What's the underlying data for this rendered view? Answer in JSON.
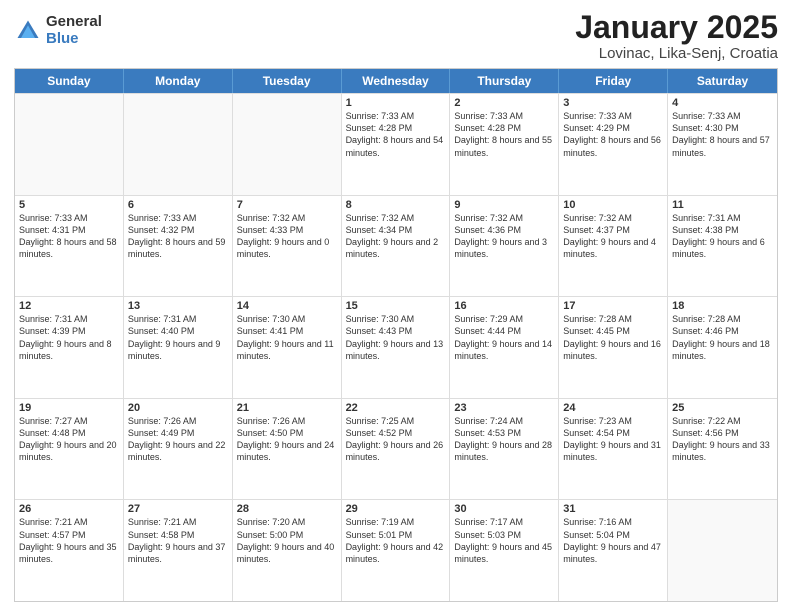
{
  "logo": {
    "general": "General",
    "blue": "Blue"
  },
  "header": {
    "title": "January 2025",
    "subtitle": "Lovinac, Lika-Senj, Croatia"
  },
  "weekdays": [
    "Sunday",
    "Monday",
    "Tuesday",
    "Wednesday",
    "Thursday",
    "Friday",
    "Saturday"
  ],
  "weeks": [
    [
      {
        "day": "",
        "info": ""
      },
      {
        "day": "",
        "info": ""
      },
      {
        "day": "",
        "info": ""
      },
      {
        "day": "1",
        "info": "Sunrise: 7:33 AM\nSunset: 4:28 PM\nDaylight: 8 hours\nand 54 minutes."
      },
      {
        "day": "2",
        "info": "Sunrise: 7:33 AM\nSunset: 4:28 PM\nDaylight: 8 hours\nand 55 minutes."
      },
      {
        "day": "3",
        "info": "Sunrise: 7:33 AM\nSunset: 4:29 PM\nDaylight: 8 hours\nand 56 minutes."
      },
      {
        "day": "4",
        "info": "Sunrise: 7:33 AM\nSunset: 4:30 PM\nDaylight: 8 hours\nand 57 minutes."
      }
    ],
    [
      {
        "day": "5",
        "info": "Sunrise: 7:33 AM\nSunset: 4:31 PM\nDaylight: 8 hours\nand 58 minutes."
      },
      {
        "day": "6",
        "info": "Sunrise: 7:33 AM\nSunset: 4:32 PM\nDaylight: 8 hours\nand 59 minutes."
      },
      {
        "day": "7",
        "info": "Sunrise: 7:32 AM\nSunset: 4:33 PM\nDaylight: 9 hours\nand 0 minutes."
      },
      {
        "day": "8",
        "info": "Sunrise: 7:32 AM\nSunset: 4:34 PM\nDaylight: 9 hours\nand 2 minutes."
      },
      {
        "day": "9",
        "info": "Sunrise: 7:32 AM\nSunset: 4:36 PM\nDaylight: 9 hours\nand 3 minutes."
      },
      {
        "day": "10",
        "info": "Sunrise: 7:32 AM\nSunset: 4:37 PM\nDaylight: 9 hours\nand 4 minutes."
      },
      {
        "day": "11",
        "info": "Sunrise: 7:31 AM\nSunset: 4:38 PM\nDaylight: 9 hours\nand 6 minutes."
      }
    ],
    [
      {
        "day": "12",
        "info": "Sunrise: 7:31 AM\nSunset: 4:39 PM\nDaylight: 9 hours\nand 8 minutes."
      },
      {
        "day": "13",
        "info": "Sunrise: 7:31 AM\nSunset: 4:40 PM\nDaylight: 9 hours\nand 9 minutes."
      },
      {
        "day": "14",
        "info": "Sunrise: 7:30 AM\nSunset: 4:41 PM\nDaylight: 9 hours\nand 11 minutes."
      },
      {
        "day": "15",
        "info": "Sunrise: 7:30 AM\nSunset: 4:43 PM\nDaylight: 9 hours\nand 13 minutes."
      },
      {
        "day": "16",
        "info": "Sunrise: 7:29 AM\nSunset: 4:44 PM\nDaylight: 9 hours\nand 14 minutes."
      },
      {
        "day": "17",
        "info": "Sunrise: 7:28 AM\nSunset: 4:45 PM\nDaylight: 9 hours\nand 16 minutes."
      },
      {
        "day": "18",
        "info": "Sunrise: 7:28 AM\nSunset: 4:46 PM\nDaylight: 9 hours\nand 18 minutes."
      }
    ],
    [
      {
        "day": "19",
        "info": "Sunrise: 7:27 AM\nSunset: 4:48 PM\nDaylight: 9 hours\nand 20 minutes."
      },
      {
        "day": "20",
        "info": "Sunrise: 7:26 AM\nSunset: 4:49 PM\nDaylight: 9 hours\nand 22 minutes."
      },
      {
        "day": "21",
        "info": "Sunrise: 7:26 AM\nSunset: 4:50 PM\nDaylight: 9 hours\nand 24 minutes."
      },
      {
        "day": "22",
        "info": "Sunrise: 7:25 AM\nSunset: 4:52 PM\nDaylight: 9 hours\nand 26 minutes."
      },
      {
        "day": "23",
        "info": "Sunrise: 7:24 AM\nSunset: 4:53 PM\nDaylight: 9 hours\nand 28 minutes."
      },
      {
        "day": "24",
        "info": "Sunrise: 7:23 AM\nSunset: 4:54 PM\nDaylight: 9 hours\nand 31 minutes."
      },
      {
        "day": "25",
        "info": "Sunrise: 7:22 AM\nSunset: 4:56 PM\nDaylight: 9 hours\nand 33 minutes."
      }
    ],
    [
      {
        "day": "26",
        "info": "Sunrise: 7:21 AM\nSunset: 4:57 PM\nDaylight: 9 hours\nand 35 minutes."
      },
      {
        "day": "27",
        "info": "Sunrise: 7:21 AM\nSunset: 4:58 PM\nDaylight: 9 hours\nand 37 minutes."
      },
      {
        "day": "28",
        "info": "Sunrise: 7:20 AM\nSunset: 5:00 PM\nDaylight: 9 hours\nand 40 minutes."
      },
      {
        "day": "29",
        "info": "Sunrise: 7:19 AM\nSunset: 5:01 PM\nDaylight: 9 hours\nand 42 minutes."
      },
      {
        "day": "30",
        "info": "Sunrise: 7:17 AM\nSunset: 5:03 PM\nDaylight: 9 hours\nand 45 minutes."
      },
      {
        "day": "31",
        "info": "Sunrise: 7:16 AM\nSunset: 5:04 PM\nDaylight: 9 hours\nand 47 minutes."
      },
      {
        "day": "",
        "info": ""
      }
    ]
  ]
}
